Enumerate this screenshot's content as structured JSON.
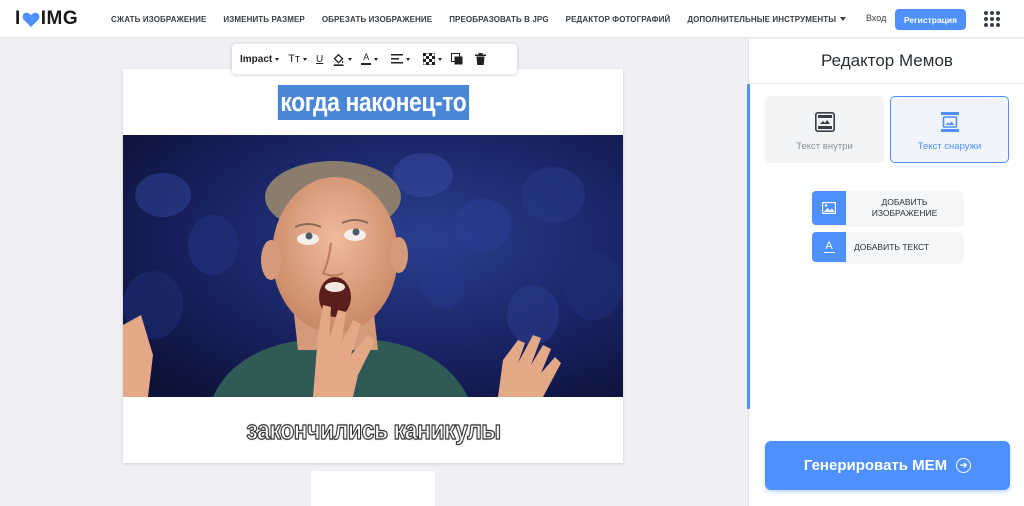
{
  "header": {
    "logo_left": "I",
    "logo_right": "IMG",
    "nav": [
      {
        "label": "СЖАТЬ ИЗОБРАЖЕНИЕ"
      },
      {
        "label": "ИЗМЕНИТЬ РАЗМЕР"
      },
      {
        "label": "ОБРЕЗАТЬ ИЗОБРАЖЕНИЕ"
      },
      {
        "label": "ПРЕОБРАЗОВАТЬ В JPG"
      },
      {
        "label": "РЕДАКТОР ФОТОГРАФИЙ"
      },
      {
        "label": "ДОПОЛНИТЕЛЬНЫЕ ИНСТРУМЕНТЫ"
      }
    ],
    "login": "Вход",
    "register": "Регистрация"
  },
  "toolbar": {
    "font": "Impact",
    "text_size": "Tт",
    "underline": "U",
    "text_color_glyph": "A"
  },
  "meme": {
    "top_text": "когда наконец-то",
    "bottom_text": "закончились каникулы"
  },
  "panel": {
    "title": "Редактор Мемов",
    "mode_inside": "Текст внутри",
    "mode_outside": "Текст снаружи",
    "selected_mode": "outside",
    "add_image": "ДОБАВИТЬ ИЗОБРАЖЕНИЕ",
    "add_text": "ДОБАВИТЬ ТЕКСТ",
    "text_icon_glyph": "A",
    "generate": "Генерировать МЕМ"
  },
  "colors": {
    "accent": "#4d90fe",
    "logo_heart": "#4d90fe",
    "selection": "#4a86d8"
  }
}
